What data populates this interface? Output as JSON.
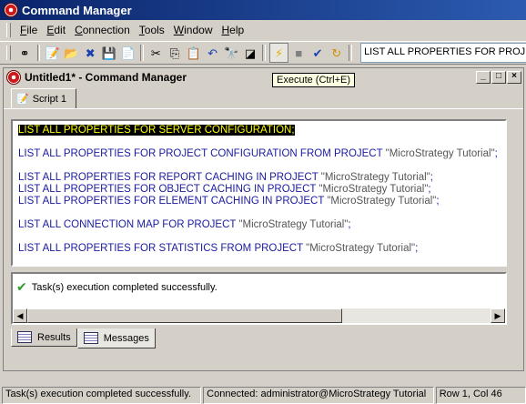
{
  "app": {
    "title": "Command Manager"
  },
  "menu": {
    "items": [
      {
        "u": "F",
        "rest": "ile"
      },
      {
        "u": "E",
        "rest": "dit"
      },
      {
        "u": "C",
        "rest": "onnection"
      },
      {
        "u": "T",
        "rest": "ools"
      },
      {
        "u": "W",
        "rest": "indow"
      },
      {
        "u": "H",
        "rest": "elp"
      }
    ]
  },
  "toolbar": {
    "command_text": "LIST ALL PROPERTIES FOR PROJECT C",
    "tooltip": "Execute (Ctrl+E)",
    "icons": [
      "connect-icon",
      "new-icon",
      "open-icon",
      "close-icon",
      "save-icon",
      "save-as-icon",
      "cut-icon",
      "copy-icon",
      "paste-icon",
      "undo-icon",
      "find-icon",
      "clear-icon",
      "execute-icon",
      "stop-icon",
      "check-syntax-icon",
      "step-icon"
    ]
  },
  "child_window": {
    "title": "Untitled1* - Command Manager",
    "script_tab": "Script 1"
  },
  "editor": {
    "lines": [
      {
        "kw": "LIST ALL PROPERTIES FOR SERVER CONFIGURATION;",
        "str": "",
        "end": "",
        "selected": true
      },
      {
        "blank": true
      },
      {
        "kw": "LIST ALL PROPERTIES FOR PROJECT CONFIGURATION FROM PROJECT ",
        "str": "\"MicroStrategy Tutorial\"",
        "end": ";"
      },
      {
        "blank": true
      },
      {
        "kw": "LIST ALL PROPERTIES FOR REPORT CACHING IN PROJECT ",
        "str": "\"MicroStrategy Tutorial\"",
        "end": ";"
      },
      {
        "kw": "LIST ALL PROPERTIES FOR OBJECT CACHING IN PROJECT ",
        "str": "\"MicroStrategy Tutorial\"",
        "end": ";"
      },
      {
        "kw": "LIST ALL PROPERTIES FOR ELEMENT CACHING IN PROJECT ",
        "str": "\"MicroStrategy Tutorial\"",
        "end": ";"
      },
      {
        "blank": true
      },
      {
        "kw": "LIST ALL CONNECTION MAP FOR PROJECT ",
        "str": "\"MicroStrategy Tutorial\"",
        "end": ";"
      },
      {
        "blank": true
      },
      {
        "kw": "LIST ALL PROPERTIES FOR STATISTICS FROM PROJECT ",
        "str": "\"MicroStrategy Tutorial\"",
        "end": ";"
      }
    ]
  },
  "messages": {
    "text": "Task(s) execution completed successfully."
  },
  "bottom_tabs": {
    "results": "Results",
    "messages": "Messages"
  },
  "status": {
    "message": "Task(s) execution completed successfully.",
    "connection": "Connected: administrator@MicroStrategy Tutorial",
    "position": "Row 1, Col 46"
  }
}
